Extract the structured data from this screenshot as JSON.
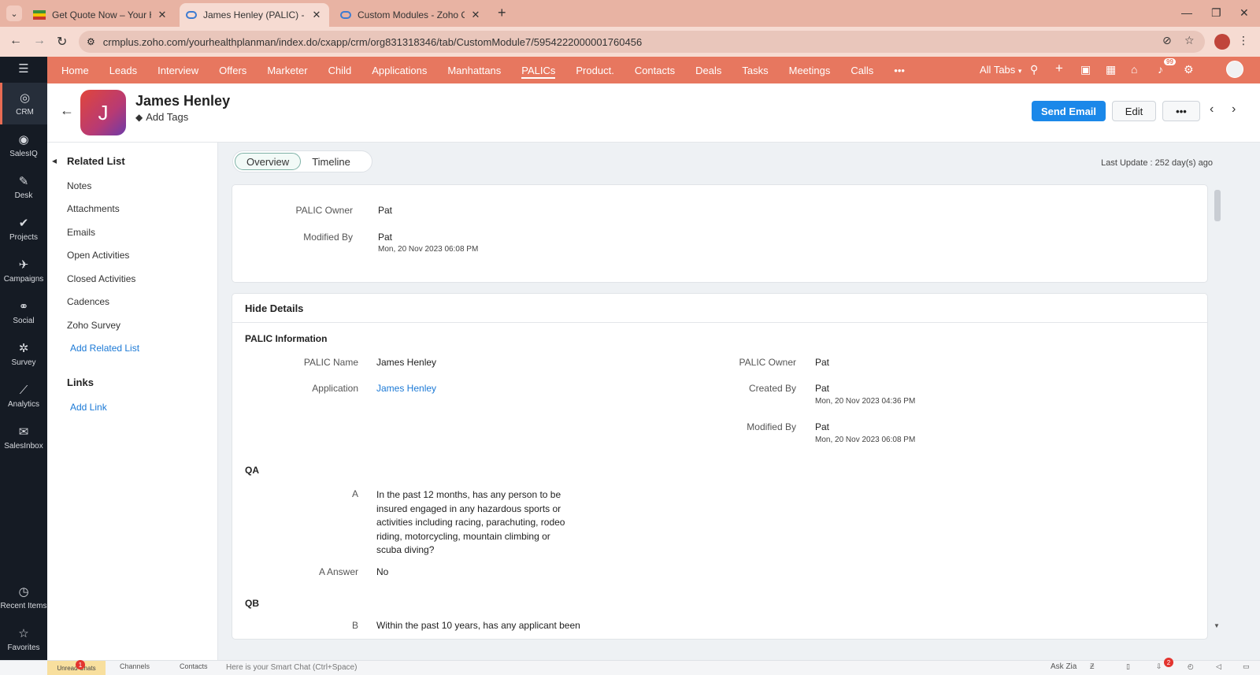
{
  "browser": {
    "tabs": [
      {
        "title": "Get Quote Now – Your Health P",
        "active": false
      },
      {
        "title": "James Henley (PALIC) - Zoho CR",
        "active": true
      },
      {
        "title": "Custom Modules - Zoho CRM",
        "active": false
      }
    ],
    "url": "crmplus.zoho.com/yourhealthplanman/index.do/cxapp/crm/org831318346/tab/CustomModule7/5954222000001760456"
  },
  "rail": {
    "items": [
      {
        "label": "CRM",
        "icon": "crm-icon"
      },
      {
        "label": "SalesIQ",
        "icon": "salesiq-icon"
      },
      {
        "label": "Desk",
        "icon": "desk-icon"
      },
      {
        "label": "Projects",
        "icon": "projects-icon"
      },
      {
        "label": "Campaigns",
        "icon": "campaigns-icon"
      },
      {
        "label": "Social",
        "icon": "social-icon"
      },
      {
        "label": "Survey",
        "icon": "survey-icon"
      },
      {
        "label": "Analytics",
        "icon": "analytics-icon"
      },
      {
        "label": "SalesInbox",
        "icon": "salesinbox-icon"
      }
    ],
    "bottom": [
      {
        "label": "Recent Items",
        "icon": "clock-icon"
      },
      {
        "label": "Favorites",
        "icon": "star-icon"
      }
    ]
  },
  "topnav": {
    "items": [
      "Home",
      "Leads",
      "Interview",
      "Offers",
      "Marketer",
      "Child",
      "Applications",
      "Manhattans",
      "PALICs",
      "Product.",
      "Contacts",
      "Deals",
      "Tasks",
      "Meetings",
      "Calls"
    ],
    "more": "•••",
    "all_tabs": "All Tabs",
    "notification_count": "99"
  },
  "record": {
    "initial": "J",
    "name": "James Henley",
    "add_tags": "Add Tags",
    "send_email": "Send Email",
    "edit": "Edit",
    "more": "•••"
  },
  "related": {
    "heading": "Related List",
    "items": [
      "Notes",
      "Attachments",
      "Emails",
      "Open Activities",
      "Closed Activities",
      "Cadences",
      "Zoho Survey"
    ],
    "add_related": "Add Related List",
    "links_heading": "Links",
    "add_link": "Add Link"
  },
  "view_tabs": {
    "overview": "Overview",
    "timeline": "Timeline"
  },
  "last_update": "Last Update : 252 day(s) ago",
  "summary": {
    "owner_label": "PALIC Owner",
    "owner": "Pat",
    "modified_label": "Modified By",
    "modified_by": "Pat",
    "modified_time": "Mon, 20 Nov 2023 06:08 PM"
  },
  "details": {
    "hide": "Hide Details",
    "section_info": "PALIC Information",
    "name_label": "PALIC Name",
    "name": "James Henley",
    "application_label": "Application",
    "application": "James Henley",
    "owner_label": "PALIC Owner",
    "owner": "Pat",
    "created_label": "Created By",
    "created_by": "Pat",
    "created_time": "Mon, 20 Nov 2023 04:36 PM",
    "modified_label": "Modified By",
    "modified_by": "Pat",
    "modified_time": "Mon, 20 Nov 2023 06:08 PM",
    "section_qa": "QA",
    "a_label": "A",
    "a_question_lines": [
      "In the past 12 months, has any person to be",
      "insured engaged in any hazardous sports or",
      "activities including racing, parachuting, rodeo",
      "riding, motorcycling, mountain climbing or",
      "scuba diving?"
    ],
    "a_answer_label": "A Answer",
    "a_answer": "No",
    "section_qb": "QB",
    "b_label": "B",
    "b_question_partial": "Within the past 10 years, has any applicant been"
  },
  "bottombar": {
    "unread": "Unread Chats",
    "unread_count": "1",
    "channels": "Channels",
    "contacts": "Contacts",
    "smart_chat": "Here is your Smart Chat (Ctrl+Space)",
    "ask_zia": "Ask Zia",
    "download_count": "2"
  },
  "colors": {
    "nav_bg": "#e7775f",
    "rail_bg": "#151b24",
    "primary": "#1b88e9",
    "link": "#1b79d6"
  }
}
